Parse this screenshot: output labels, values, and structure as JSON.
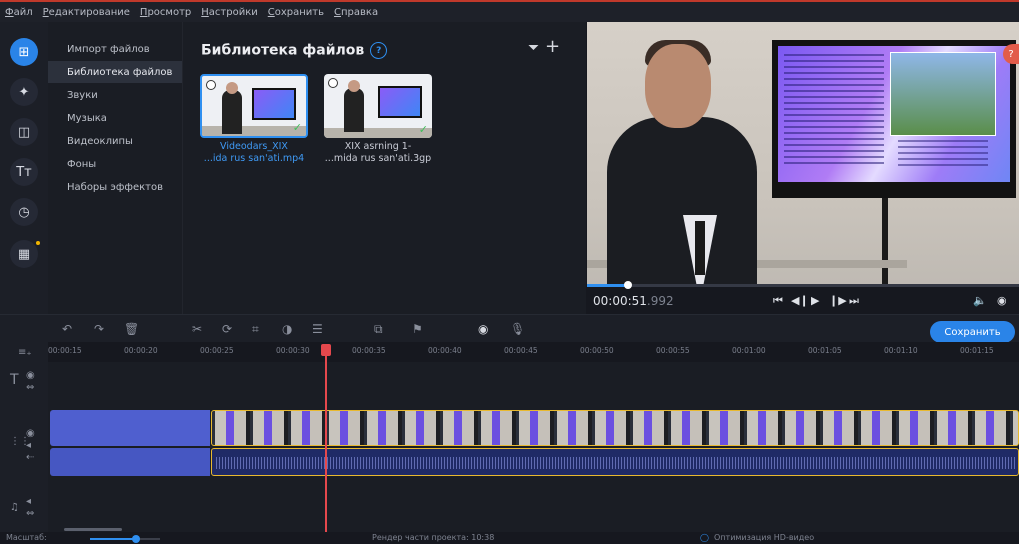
{
  "menu": [
    "Файл",
    "Редактирование",
    "Просмотр",
    "Настройки",
    "Сохранить",
    "Справка"
  ],
  "categories": [
    "Импорт файлов",
    "Библиотека файлов",
    "Звуки",
    "Музыка",
    "Видеоклипы",
    "Фоны",
    "Наборы эффектов"
  ],
  "library": {
    "title": "Библиотека файлов",
    "files": [
      {
        "line1": "Videodars_XIX",
        "line2": "...ida rus san'ati.mp4"
      },
      {
        "line1": "XIX asrning 1-",
        "line2": "...mida rus san'ati.3gp"
      }
    ]
  },
  "player": {
    "time_main": "00:00:51",
    "time_ms": ".992",
    "progress": 0.09
  },
  "toolbar": {
    "save_label": "Сохранить"
  },
  "ruler": [
    "00:00:15",
    "00:00:20",
    "00:00:25",
    "00:00:30",
    "00:00:35",
    "00:00:40",
    "00:00:45",
    "00:00:50",
    "00:00:55",
    "00:01:00",
    "00:01:05",
    "00:01:10",
    "00:01:15"
  ],
  "status": {
    "zoom_label": "Масштаб:",
    "render_label": "Рендер части проекта: 10:38",
    "hd_label": "Оптимизация HD-видео"
  },
  "colors": {
    "accent": "#2a84e8",
    "playhead": "#e5484d",
    "clip_border": "#e8b92f"
  }
}
